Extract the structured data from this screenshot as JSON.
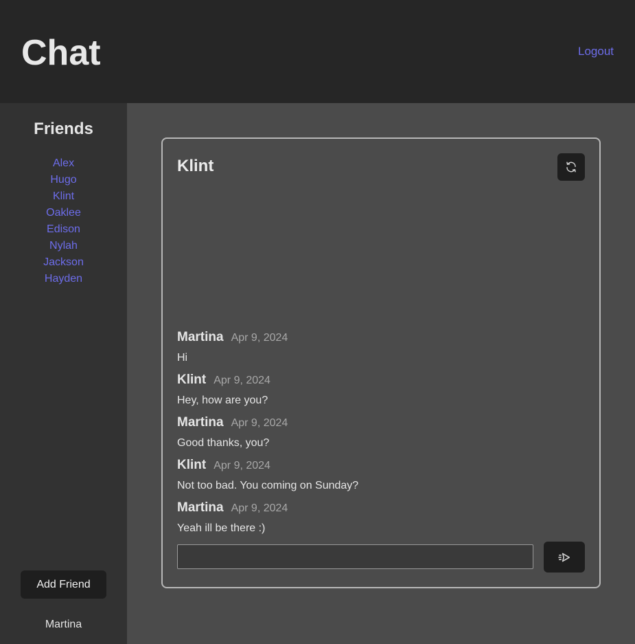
{
  "header": {
    "title": "Chat",
    "logout_label": "Logout"
  },
  "sidebar": {
    "title": "Friends",
    "friends": [
      {
        "label": "Alex"
      },
      {
        "label": "Hugo"
      },
      {
        "label": "Klint"
      },
      {
        "label": "Oaklee"
      },
      {
        "label": "Edison"
      },
      {
        "label": "Nylah"
      },
      {
        "label": "Jackson"
      },
      {
        "label": "Hayden"
      }
    ],
    "add_friend_label": "Add Friend",
    "current_user": "Martina"
  },
  "chat": {
    "title": "Klint",
    "refresh_icon": "refresh-icon",
    "send_icon": "send-icon",
    "messages": [
      {
        "author": "Martina",
        "date": "Apr 9, 2024",
        "text": "Hi"
      },
      {
        "author": "Klint",
        "date": "Apr 9, 2024",
        "text": "Hey, how are you?"
      },
      {
        "author": "Martina",
        "date": "Apr 9, 2024",
        "text": "Good thanks, you?"
      },
      {
        "author": "Klint",
        "date": "Apr 9, 2024",
        "text": "Not too bad. You coming on Sunday?"
      },
      {
        "author": "Martina",
        "date": "Apr 9, 2024",
        "text": "Yeah ill be there :)"
      }
    ],
    "input_value": "",
    "input_placeholder": ""
  },
  "colors": {
    "header_bg": "#262626",
    "sidebar_bg": "#323232",
    "main_bg": "#4b4b4b",
    "link": "#6d6dea",
    "button_bg": "#1e1e1e"
  }
}
